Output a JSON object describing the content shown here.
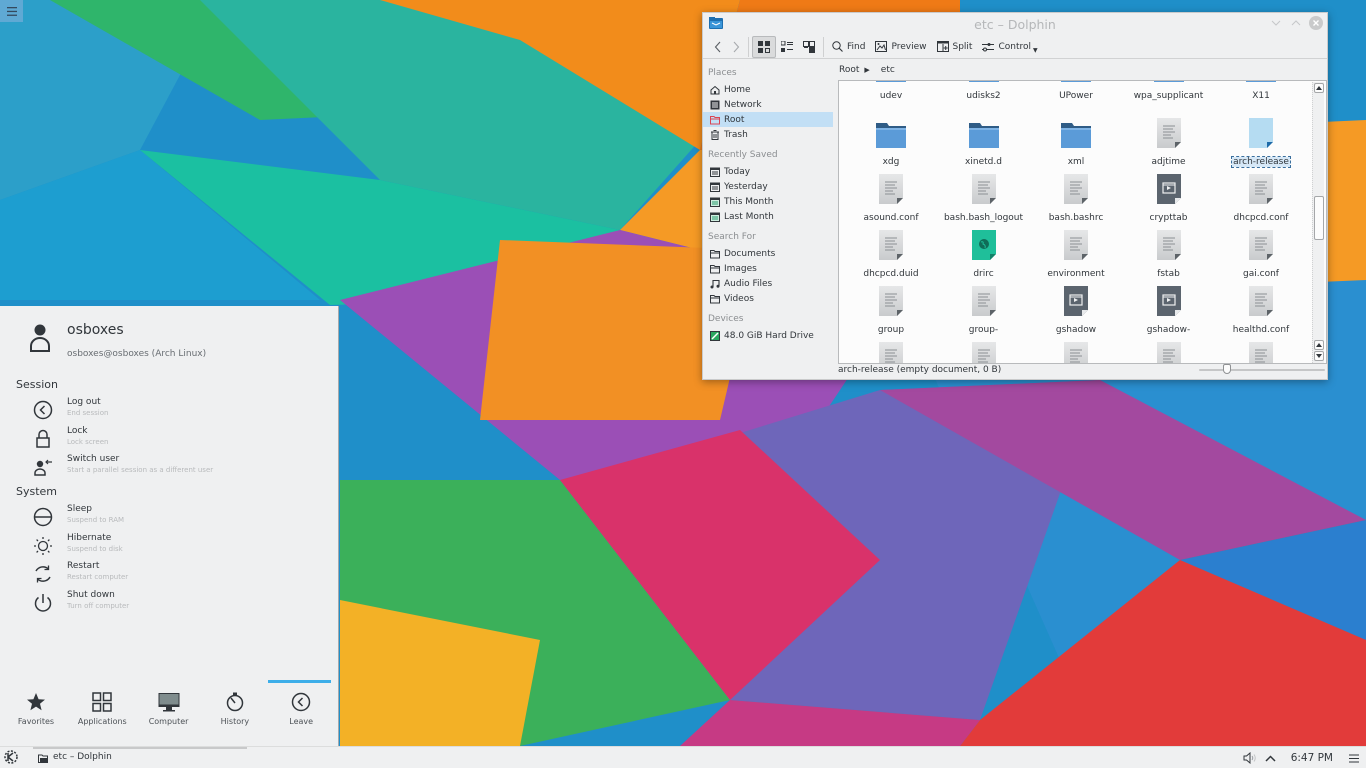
{
  "desktop": {
    "wallpaper_colors": {
      "base": "#1d8fc7",
      "green": "#2ab46a",
      "teal": "#1fbfa4",
      "orange": "#f2841a",
      "purple": "#8d55b7",
      "violet": "#6b68b9",
      "red": "#e4293c",
      "magenta": "#c6327e",
      "lime": "#6dbf2a",
      "yellow": "#f4b126"
    },
    "panel_corner_icon": "hamburger-icon"
  },
  "dolphin": {
    "title": "etc – Dolphin",
    "window_controls": [
      "minimize-icon",
      "maximize-icon",
      "close-icon"
    ],
    "toolbar": {
      "back": "back-icon",
      "forward": "forward-icon",
      "view_modes": [
        {
          "name": "icons-view",
          "active": true
        },
        {
          "name": "compact-view",
          "active": false
        },
        {
          "name": "details-view",
          "active": false
        }
      ],
      "find_label": "Find",
      "preview_label": "Preview",
      "split_label": "Split",
      "control_label": "Control"
    },
    "places": {
      "sections": [
        {
          "title": "Places",
          "items": [
            {
              "label": "Home",
              "icon": "home-icon"
            },
            {
              "label": "Network",
              "icon": "network-icon"
            },
            {
              "label": "Root",
              "icon": "root-folder-icon",
              "selected": true
            },
            {
              "label": "Trash",
              "icon": "trash-icon"
            }
          ]
        },
        {
          "title": "Recently Saved",
          "items": [
            {
              "label": "Today",
              "icon": "calendar-icon"
            },
            {
              "label": "Yesterday",
              "icon": "calendar-icon"
            },
            {
              "label": "This Month",
              "icon": "calendar-icon"
            },
            {
              "label": "Last Month",
              "icon": "calendar-icon"
            }
          ]
        },
        {
          "title": "Search For",
          "items": [
            {
              "label": "Documents",
              "icon": "folder-icon"
            },
            {
              "label": "Images",
              "icon": "folder-icon"
            },
            {
              "label": "Audio Files",
              "icon": "music-icon"
            },
            {
              "label": "Videos",
              "icon": "folder-icon"
            }
          ]
        },
        {
          "title": "Devices",
          "items": [
            {
              "label": "48.0 GiB Hard Drive",
              "icon": "hard-drive-icon"
            }
          ]
        }
      ]
    },
    "breadcrumb": {
      "root": "Root",
      "current": "etc"
    },
    "files": [
      {
        "name": "udev",
        "type": "folder"
      },
      {
        "name": "udisks2",
        "type": "folder"
      },
      {
        "name": "UPower",
        "type": "folder"
      },
      {
        "name": "wpa_supplicant",
        "type": "folder"
      },
      {
        "name": "X11",
        "type": "folder"
      },
      {
        "name": "xdg",
        "type": "folder"
      },
      {
        "name": "xinetd.d",
        "type": "folder"
      },
      {
        "name": "xml",
        "type": "folder"
      },
      {
        "name": "adjtime",
        "type": "text"
      },
      {
        "name": "arch-release",
        "type": "empty",
        "selected": true
      },
      {
        "name": "asound.conf",
        "type": "text"
      },
      {
        "name": "bash.bash_logout",
        "type": "text"
      },
      {
        "name": "bash.bashrc",
        "type": "text"
      },
      {
        "name": "crypttab",
        "type": "exec"
      },
      {
        "name": "dhcpcd.conf",
        "type": "text"
      },
      {
        "name": "dhcpcd.duid",
        "type": "text"
      },
      {
        "name": "drirc",
        "type": "html"
      },
      {
        "name": "environment",
        "type": "text"
      },
      {
        "name": "fstab",
        "type": "text"
      },
      {
        "name": "gai.conf",
        "type": "text"
      },
      {
        "name": "group",
        "type": "text"
      },
      {
        "name": "group-",
        "type": "text"
      },
      {
        "name": "gshadow",
        "type": "exec"
      },
      {
        "name": "gshadow-",
        "type": "exec"
      },
      {
        "name": "healthd.conf",
        "type": "text"
      },
      {
        "name": "",
        "type": "text"
      },
      {
        "name": "",
        "type": "text"
      },
      {
        "name": "",
        "type": "text"
      },
      {
        "name": "",
        "type": "text"
      },
      {
        "name": "",
        "type": "text"
      }
    ],
    "status_text": "arch-release (empty document, 0 B)",
    "zoom_level_fraction": 0.2
  },
  "launcher": {
    "user": {
      "name": "osboxes",
      "subtitle": "osboxes@osboxes (Arch Linux)"
    },
    "session_title": "Session",
    "session_items": [
      {
        "title": "Log out",
        "subtitle": "End session",
        "icon": "logout-icon"
      },
      {
        "title": "Lock",
        "subtitle": "Lock screen",
        "icon": "lock-icon"
      },
      {
        "title": "Switch user",
        "subtitle": "Start a parallel session as a different user",
        "icon": "switch-user-icon"
      }
    ],
    "system_title": "System",
    "system_items": [
      {
        "title": "Sleep",
        "subtitle": "Suspend to RAM",
        "icon": "sleep-icon"
      },
      {
        "title": "Hibernate",
        "subtitle": "Suspend to disk",
        "icon": "hibernate-icon"
      },
      {
        "title": "Restart",
        "subtitle": "Restart computer",
        "icon": "restart-icon"
      },
      {
        "title": "Shut down",
        "subtitle": "Turn off computer",
        "icon": "shutdown-icon"
      }
    ],
    "tabs": [
      {
        "label": "Favorites",
        "icon": "star-icon"
      },
      {
        "label": "Applications",
        "icon": "applications-icon"
      },
      {
        "label": "Computer",
        "icon": "computer-icon"
      },
      {
        "label": "History",
        "icon": "history-icon"
      },
      {
        "label": "Leave",
        "icon": "leave-icon",
        "active": true
      }
    ]
  },
  "taskbar": {
    "launcher_icon": "kde-icon",
    "task_label": "etc – Dolphin",
    "tray": [
      "volume-icon",
      "expand-tray-icon"
    ],
    "clock": "6:47 PM",
    "menu_icon": "panel-menu-icon"
  }
}
